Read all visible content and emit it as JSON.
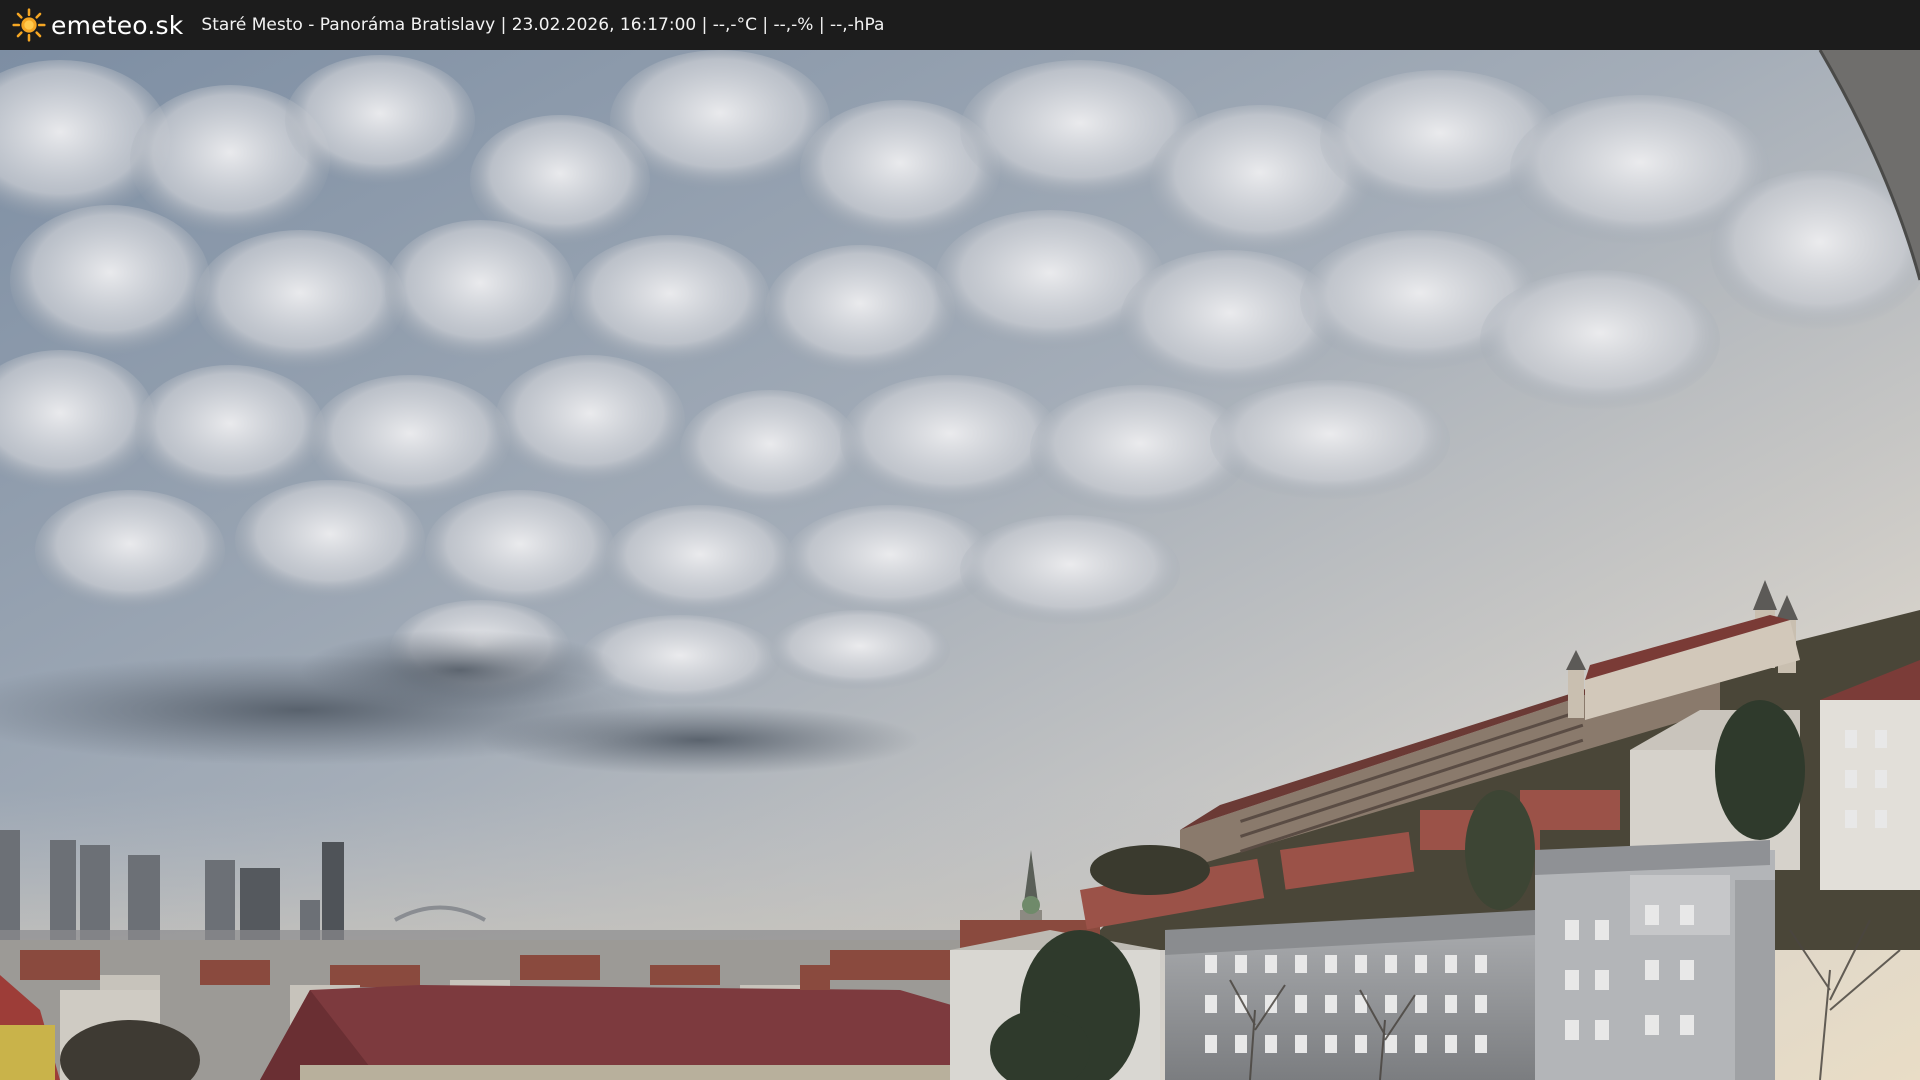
{
  "header": {
    "brand": "emeteo.sk",
    "caption": "Staré Mesto - Panoráma Bratislavy | 23.02.2026, 16:17:00 | --,-°C | --,-% | --,-hPa",
    "logo_icon": "sun-icon",
    "background": "#1c1c1c",
    "accent": "#f5a623"
  },
  "scene": {
    "sky_color": "#8e9aa8",
    "cloud_color": "#e6e6e8",
    "horizon_glow": "#e8dcc8",
    "castle_wall_color": "#8a7a6c",
    "roof_color": "#7d3a3e"
  }
}
